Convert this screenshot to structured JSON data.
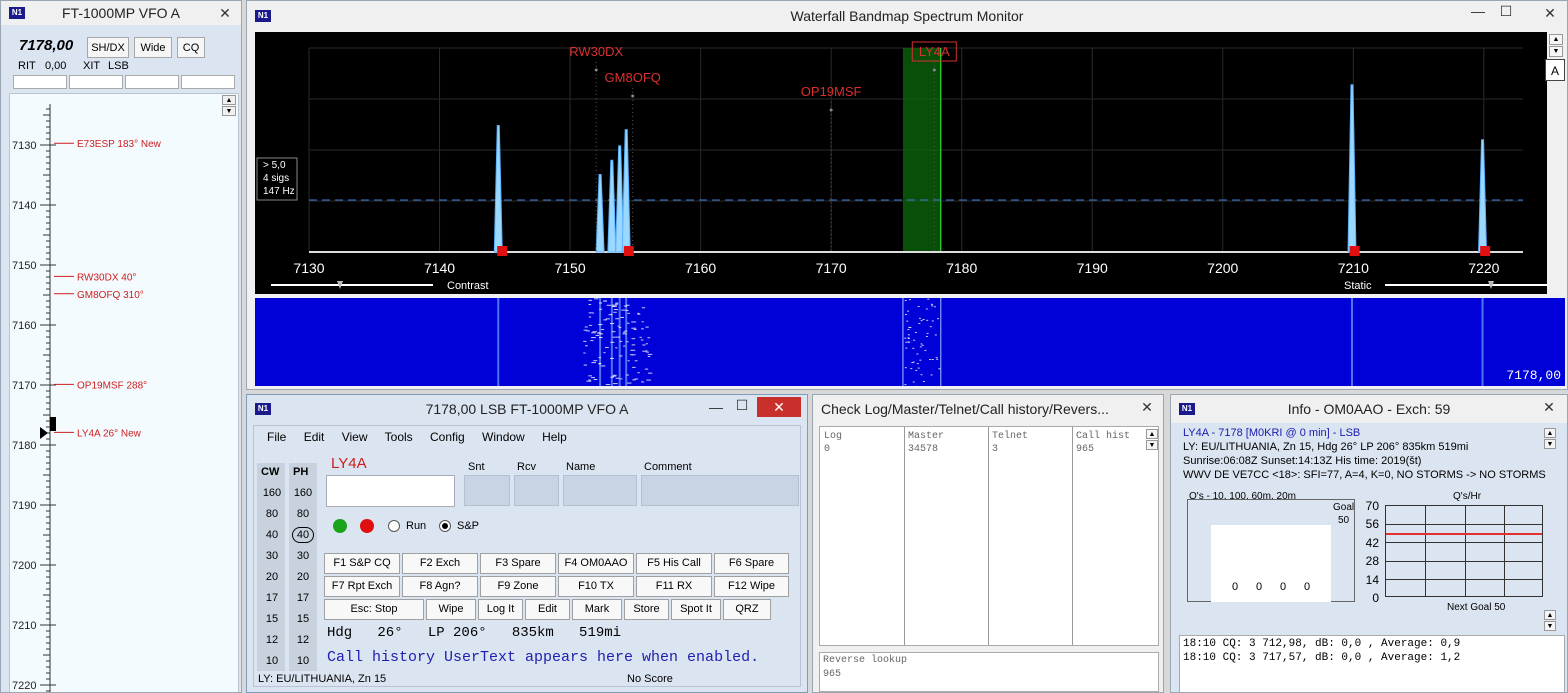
{
  "vfo": {
    "title": "FT-1000MP VFO A",
    "freq": "7178,00",
    "btn_shdx": "SH/DX",
    "btn_wide": "Wide",
    "btn_cq": "CQ",
    "rit_label": "RIT",
    "rit_value": "0,00",
    "xit_label": "XIT",
    "mode": "LSB",
    "scale": [
      {
        "f": 7130,
        "label": "7130"
      },
      {
        "f": 7140,
        "label": "7140"
      },
      {
        "f": 7150,
        "label": "7150"
      },
      {
        "f": 7160,
        "label": "7160"
      },
      {
        "f": 7170,
        "label": "7170"
      },
      {
        "f": 7180,
        "label": "7180"
      },
      {
        "f": 7190,
        "label": "7190"
      },
      {
        "f": 7200,
        "label": "7200"
      },
      {
        "f": 7210,
        "label": "7210"
      },
      {
        "f": 7220,
        "label": "7220"
      }
    ],
    "spots": [
      {
        "f": 7129.7,
        "text": "E73ESP 183° New"
      },
      {
        "f": 7151.9,
        "text": "RW30DX 40°"
      },
      {
        "f": 7154.8,
        "text": "GM8OFQ 310°"
      },
      {
        "f": 7169.9,
        "text": "OP19MSF 288°"
      },
      {
        "f": 7177.9,
        "text": "LY4A 26° New"
      }
    ]
  },
  "bandmap": {
    "title": "Waterfall Bandmap Spectrum Monitor",
    "x_ticks": [
      7130,
      7140,
      7150,
      7160,
      7170,
      7180,
      7190,
      7200,
      7210,
      7220
    ],
    "xlim": [
      7130,
      7223
    ],
    "spots": [
      {
        "call": "RW30DX",
        "f": 7152
      },
      {
        "call": "GM8OFQ",
        "f": 7154.8
      },
      {
        "call": "OP19MSF",
        "f": 7170
      },
      {
        "call": "LY4A",
        "f": 7177.9
      }
    ],
    "signals": [
      {
        "f": 7144.5,
        "level": 0.62
      },
      {
        "f": 7152.3,
        "level": 0.38
      },
      {
        "f": 7153.2,
        "level": 0.45
      },
      {
        "f": 7153.8,
        "level": 0.52
      },
      {
        "f": 7154.3,
        "level": 0.6
      },
      {
        "f": 7209.9,
        "level": 0.82
      },
      {
        "f": 7219.9,
        "level": 0.55
      }
    ],
    "info_box": [
      "> 5,0",
      "4 sigs",
      "147 Hz"
    ],
    "contrast_label": "Contrast",
    "static_label": "Static",
    "waterfall_freq": "7178,00",
    "side_btn": "A"
  },
  "entry": {
    "title": "7178,00 LSB FT-1000MP VFO A",
    "menu": [
      "File",
      "Edit",
      "View",
      "Tools",
      "Config",
      "Window",
      "Help"
    ],
    "cw_header": "CW",
    "ph_header": "PH",
    "rates": [
      "160",
      "80",
      "40",
      "30",
      "20",
      "17",
      "15",
      "12",
      "10"
    ],
    "call": "LY4A",
    "field_labels": [
      "Snt",
      "Rcv",
      "Name",
      "Comment"
    ],
    "run_label": "Run",
    "sp_label": "S&P",
    "fkeys": [
      [
        "F1 S&P CQ",
        "F2 Exch",
        "F3 Spare",
        "F4 OM0AAO",
        "F5 His Call",
        "F6 Spare"
      ],
      [
        "F7 Rpt Exch",
        "F8 Agn?",
        "F9 Zone",
        "F10 TX",
        "F11 RX",
        "F12 Wipe"
      ],
      [
        "Esc: Stop",
        "Wipe",
        "Log It",
        "Edit",
        "Mark",
        "Store",
        "Spot It",
        "QRZ"
      ]
    ],
    "bearing": "Hdg   26°   LP 206°   835km   519mi",
    "usertext": "Call history UserText appears here when enabled.",
    "status_left": "LY: EU/LITHUANIA, Zn 15",
    "status_right": "No Score"
  },
  "check": {
    "title": "Check Log/Master/Telnet/Call history/Revers...",
    "cols": [
      {
        "label": "Log",
        "value": "0"
      },
      {
        "label": "Master",
        "value": "34578"
      },
      {
        "label": "Telnet",
        "value": "3"
      },
      {
        "label": "Call hist",
        "value": "965"
      }
    ],
    "reverse_label": "Reverse lookup",
    "reverse_value": "965"
  },
  "info": {
    "title": "Info - OM0AAO - Exch: 59",
    "line1": "LY4A - 7178 [M0KRI @ 0 min] - LSB",
    "line2": "LY: EU/LITHUANIA, Zn 15, Hdg  26°  LP 206°  835km  519mi",
    "line3": "Sunrise:06:08Z Sunset:14:13Z His time: 2019(št)",
    "line4": "WWV DE VE7CC <18>:   SFI=77, A=4, K=0, NO STORMS -> NO STORMS",
    "chart1_title": "Q's - 10, 100, 60m, 20m",
    "goal_label": "Goal",
    "goal_value": "50",
    "bar_values": [
      "0",
      "0",
      "0",
      "0"
    ],
    "chart2_title": "Q's/Hr",
    "y_ticks": [
      "70",
      "56",
      "42",
      "28",
      "14",
      "0"
    ],
    "next_goal": "Next Goal 50",
    "log_lines": [
      "18:10 CQ: 3 712,98, dB: 0,0 , Average: 0,9",
      "18:10 CQ: 3 717,57, dB: 0,0 , Average: 1,2"
    ]
  },
  "colors": {
    "spot": "#cc2020",
    "spectrum_bg": "#000000",
    "waterfall": "#0000d8",
    "panel": "#dbe5f1"
  }
}
